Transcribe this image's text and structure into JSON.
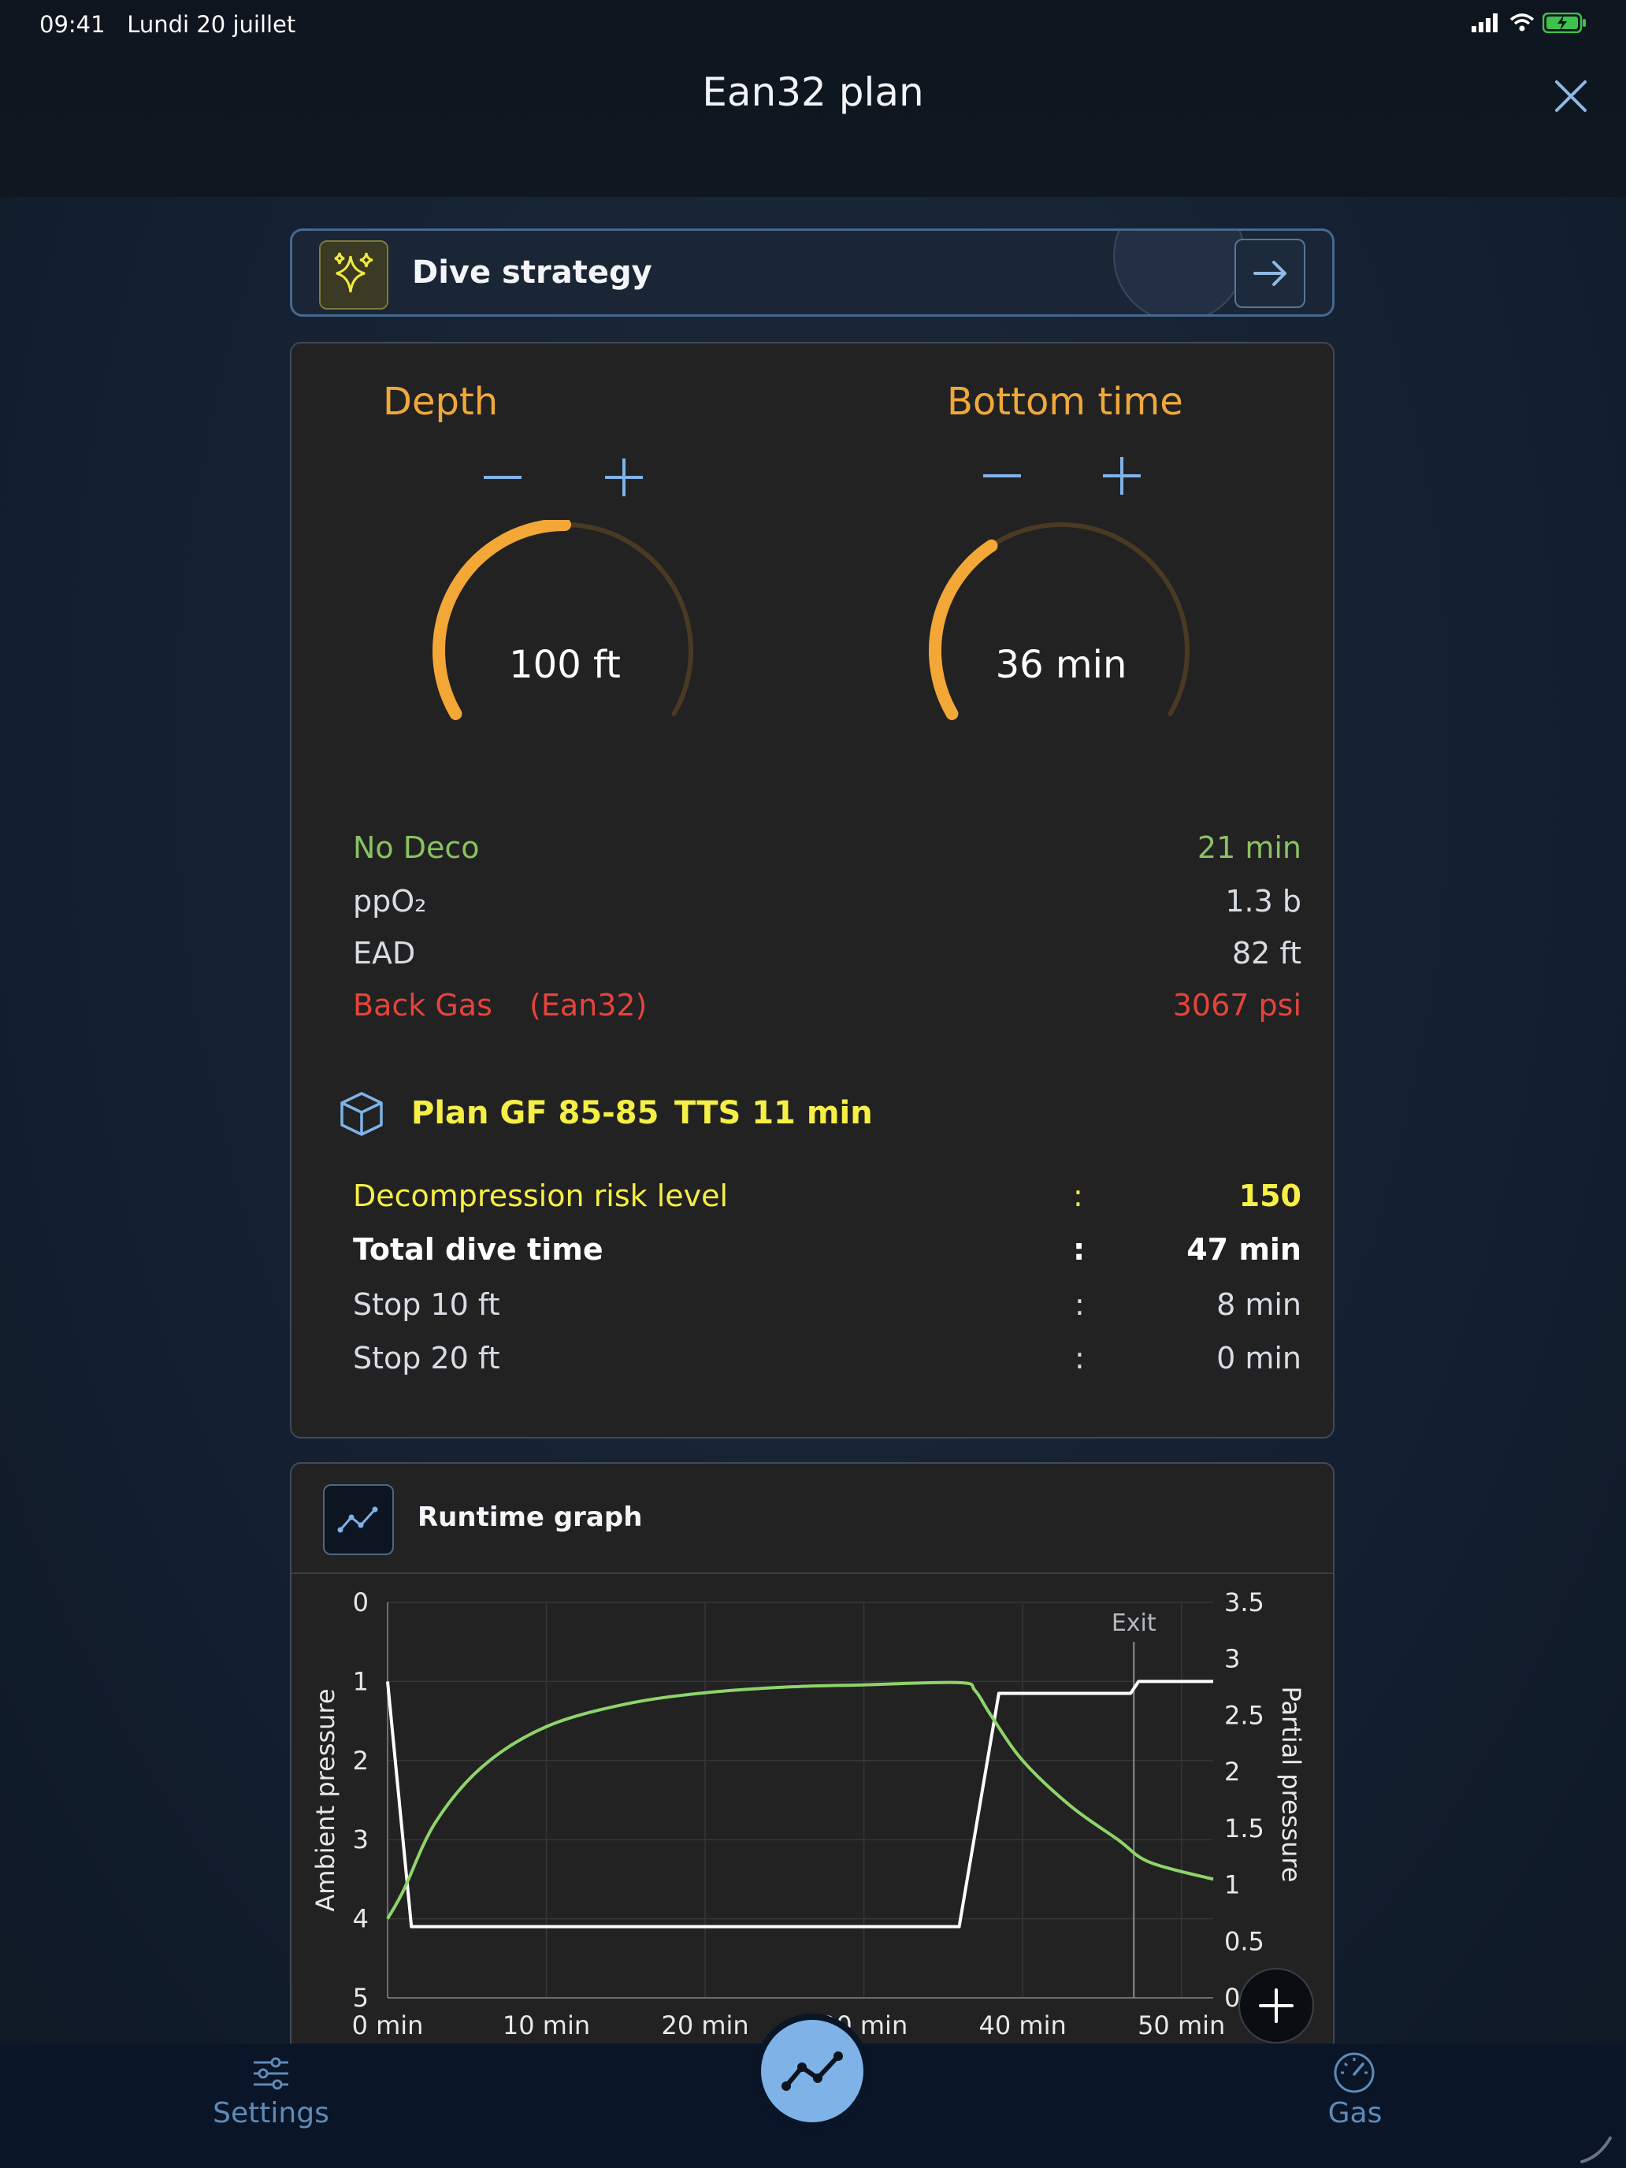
{
  "status_bar": {
    "time": "09:41",
    "date": "Lundi 20 juillet"
  },
  "header": {
    "title": "Ean32 plan"
  },
  "strategy": {
    "label": "Dive strategy"
  },
  "depth": {
    "label": "Depth",
    "value": "100 ft",
    "fraction": 0.5
  },
  "bottom_time": {
    "label": "Bottom time",
    "value": "36 min",
    "fraction": 0.36
  },
  "stats": [
    {
      "label": "No Deco",
      "value": "21 min",
      "color": "#89c262"
    },
    {
      "label": "ppO₂",
      "value": "1.3 b",
      "color": "#d8dde3"
    },
    {
      "label": "EAD",
      "value": "82 ft",
      "color": "#d8dde3"
    },
    {
      "label": "Back Gas",
      "extra": "(Ean32)",
      "value": "3067 psi",
      "color": "#e5443b"
    }
  ],
  "plan": {
    "title": "Plan GF 85-85",
    "tts": "TTS 11 min",
    "rows": [
      {
        "label": "Decompression risk level",
        "sep": ":",
        "value": "150"
      },
      {
        "label": "Total dive time",
        "sep": ":",
        "value": "47 min"
      },
      {
        "label": "Stop  10 ft",
        "sep": ":",
        "value": "8 min"
      },
      {
        "label": "Stop  20 ft",
        "sep": ":",
        "value": "0 min"
      }
    ]
  },
  "graph": {
    "title": "Runtime graph"
  },
  "chart_data": {
    "type": "line",
    "xlabel": "",
    "ylabel": "Ambient pressure",
    "y2label": "Partial pressure",
    "xlim": [
      0,
      52
    ],
    "ylim": [
      0,
      5
    ],
    "y2lim": [
      0,
      3.5
    ],
    "x_ticks": [
      "0 min",
      "10 min",
      "20 min",
      "30 min",
      "40 min",
      "50 min"
    ],
    "y_ticks": [
      "0",
      "1",
      "2",
      "3",
      "4",
      "5"
    ],
    "y2_ticks": [
      "3.5",
      "3",
      "2.5",
      "2",
      "1.5",
      "1",
      "0.5",
      "0"
    ],
    "annotations": [
      {
        "text": "Exit",
        "x": 47
      }
    ],
    "series": [
      {
        "color": "#ffffff",
        "axis": "left",
        "x": [
          0,
          1.5,
          36,
          38.5,
          46.8,
          47.3,
          52
        ],
        "y": [
          1,
          4.1,
          4.1,
          1.15,
          1.15,
          1.0,
          1.0
        ]
      },
      {
        "color": "#8fd46a",
        "axis": "right",
        "x": [
          0,
          1,
          3,
          6,
          10,
          15,
          20,
          25,
          30,
          36,
          37,
          38,
          40,
          43,
          46,
          48,
          52
        ],
        "y": [
          0.7,
          0.95,
          1.55,
          2.05,
          2.4,
          2.6,
          2.7,
          2.75,
          2.77,
          2.79,
          2.72,
          2.5,
          2.1,
          1.7,
          1.4,
          1.2,
          1.05
        ]
      }
    ]
  },
  "nav": {
    "settings": "Settings",
    "gas": "Gas"
  }
}
